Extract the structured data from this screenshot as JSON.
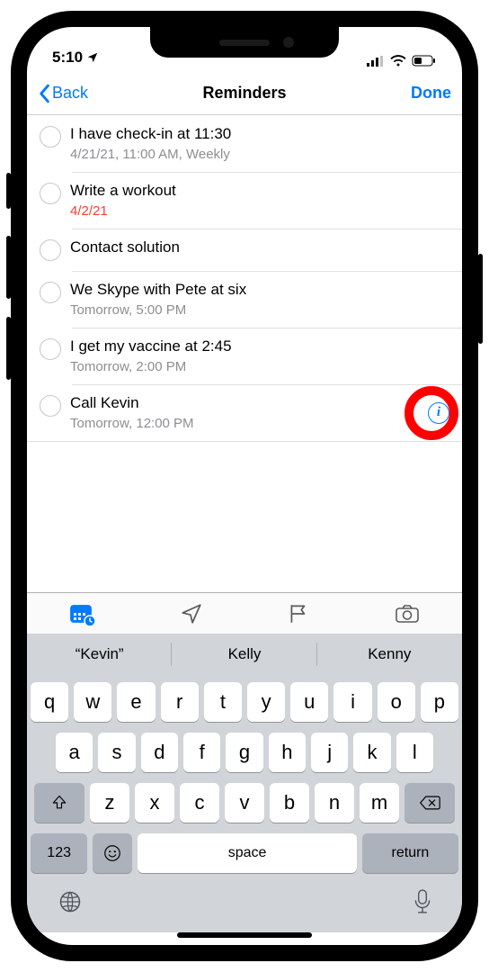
{
  "status": {
    "time": "5:10",
    "location_arrow": "▴"
  },
  "nav": {
    "back": "Back",
    "title": "Reminders",
    "done": "Done"
  },
  "reminders": [
    {
      "title": "I have check-in at 11:30",
      "sub": "4/21/21, 11:00 AM, Weekly",
      "overdue": false,
      "info": false
    },
    {
      "title": "Write a workout",
      "sub": "4/2/21",
      "overdue": true,
      "info": false
    },
    {
      "title": "Contact solution",
      "sub": "",
      "overdue": false,
      "info": false
    },
    {
      "title": "We Skype with Pete at six",
      "sub": "Tomorrow, 5:00 PM",
      "overdue": false,
      "info": false
    },
    {
      "title": "I get my vaccine at 2:45",
      "sub": "Tomorrow, 2:00 PM",
      "overdue": false,
      "info": false
    },
    {
      "title": "Call Kevin",
      "sub": "Tomorrow, 12:00 PM",
      "overdue": false,
      "info": true
    }
  ],
  "suggestions": [
    "“Kevin”",
    "Kelly",
    "Kenny"
  ],
  "keyboard": {
    "row1": [
      "q",
      "w",
      "e",
      "r",
      "t",
      "y",
      "u",
      "i",
      "o",
      "p"
    ],
    "row2": [
      "a",
      "s",
      "d",
      "f",
      "g",
      "h",
      "j",
      "k",
      "l"
    ],
    "row3": [
      "z",
      "x",
      "c",
      "v",
      "b",
      "n",
      "m"
    ],
    "numbers": "123",
    "space": "space",
    "return": "return"
  }
}
